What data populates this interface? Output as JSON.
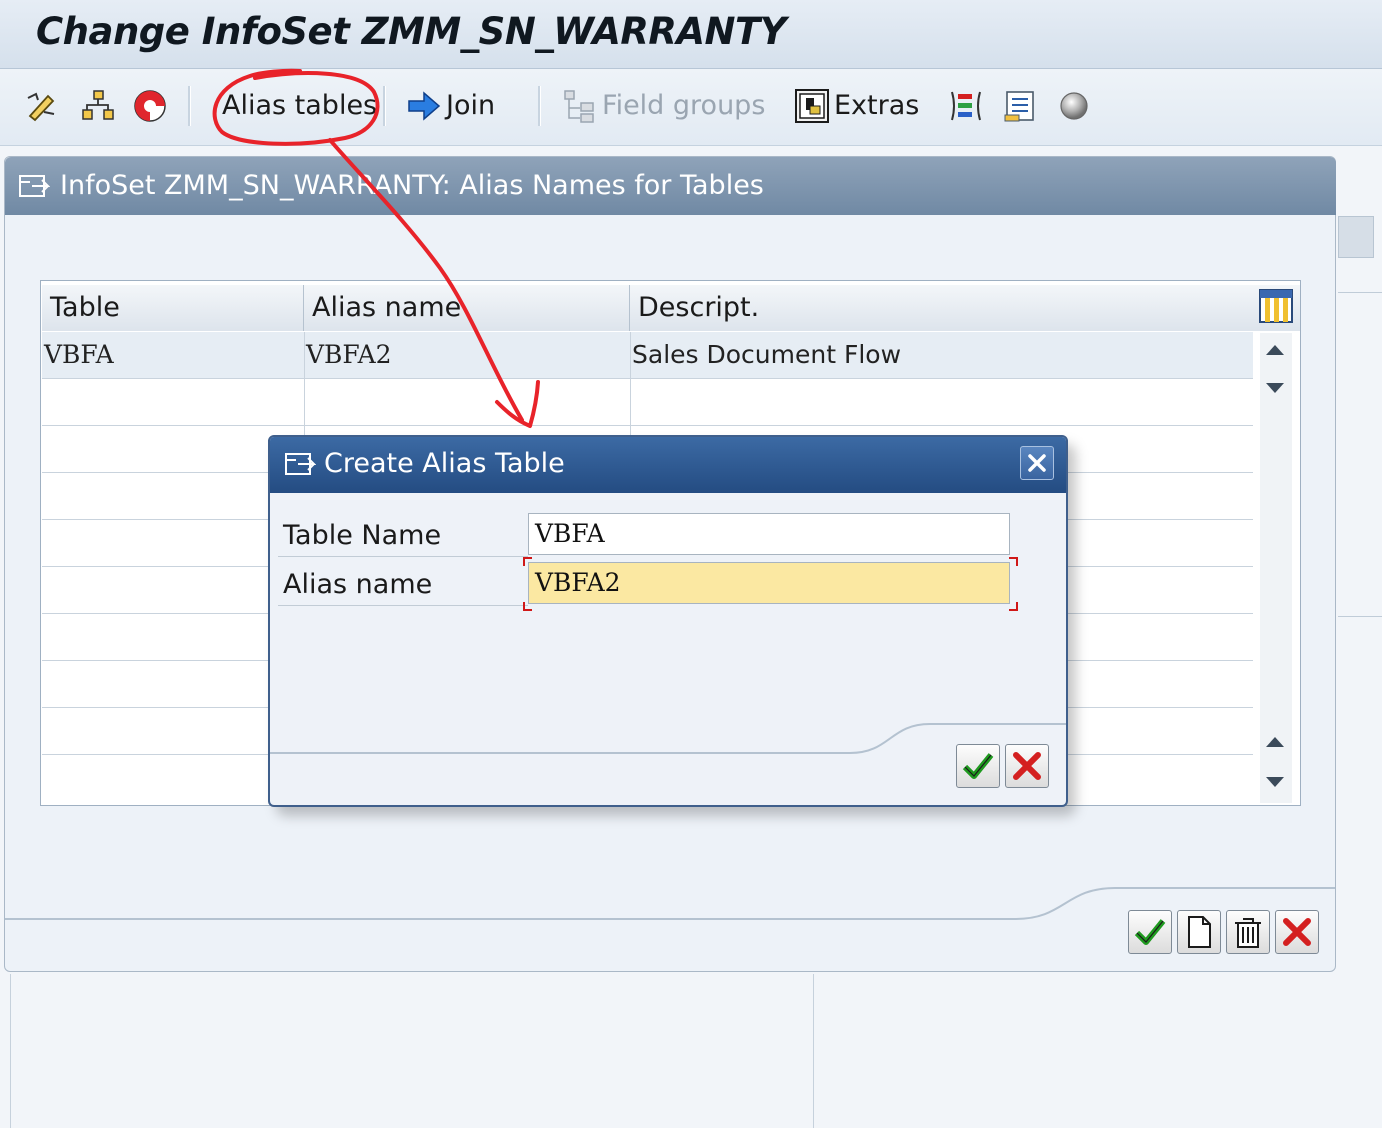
{
  "window": {
    "title": "Change InfoSet ZMM_SN_WARRANTY"
  },
  "toolbar": {
    "icons": [
      "edit-pen-icon",
      "hierarchy-icon",
      "lifebuoy-icon"
    ],
    "alias_tables_label": "Alias tables",
    "join_label": "Join",
    "field_groups_label": "Field groups",
    "extras_label": "Extras",
    "extra_icons": [
      "layout-icon",
      "list-icon",
      "circle-icon"
    ]
  },
  "panel": {
    "title": "InfoSet ZMM_SN_WARRANTY: Alias Names for Tables"
  },
  "table": {
    "columns": [
      "Table",
      "Alias name",
      "Descript."
    ],
    "rows": [
      {
        "table": "VBFA",
        "alias": "VBFA2",
        "descript": "Sales Document Flow"
      }
    ]
  },
  "dialog": {
    "title": "Create Alias Table",
    "table_name_label": "Table Name",
    "table_name_value": "VBFA",
    "alias_name_label": "Alias name",
    "alias_name_value": "VBFA2"
  },
  "colors": {
    "annotation": "#e8232a",
    "active_field": "#fbe8a2",
    "dialog_header": "#2c5589"
  }
}
